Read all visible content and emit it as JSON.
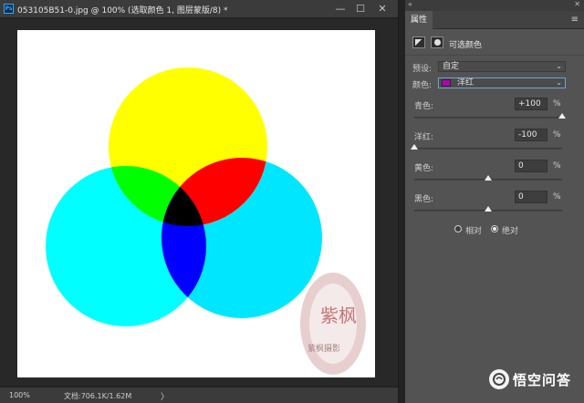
{
  "document": {
    "app_icon": "Ps",
    "title": "053105B51-0.jpg @ 100% (选取颜色 1, 图层蒙版/8) *",
    "window_controls": {
      "minimize": "—",
      "restore": "☐",
      "close": "✕"
    },
    "status": {
      "zoom": "100%",
      "doc_info": "文档:706.1K/1.62M",
      "arrow": "〉"
    },
    "image": {
      "circles": [
        {
          "name": "yellow",
          "color": "#ffff00"
        },
        {
          "name": "cyan-left",
          "color": "#00ffff"
        },
        {
          "name": "cyan-right",
          "color": "#00e6ff"
        }
      ],
      "overlaps": {
        "green": "#00ff00",
        "red": "#ff0000",
        "blue": "#0000ff",
        "black": "#000000"
      },
      "seal_char": "紫枫",
      "seal_caption": "紫枫摄影"
    }
  },
  "panel": {
    "collapse_icon": "«",
    "close_icon": "✕",
    "tab": "属性",
    "menu_icon": "≡",
    "adjustment_title": "可选颜色",
    "preset": {
      "label": "预设:",
      "value": "自定"
    },
    "colors": {
      "label": "颜色:",
      "value": "洋红",
      "swatch": "#b400b4"
    },
    "sliders": [
      {
        "label": "青色:",
        "value": "+100",
        "unit": "%",
        "level": 100
      },
      {
        "label": "洋红:",
        "value": "-100",
        "unit": "%",
        "level": -100
      },
      {
        "label": "黄色:",
        "value": "0",
        "unit": "%",
        "level": 0
      },
      {
        "label": "黑色:",
        "value": "0",
        "unit": "%",
        "level": 0
      }
    ],
    "method": {
      "relative": "相对",
      "absolute": "绝对",
      "selected": "absolute"
    }
  },
  "watermark": {
    "text": "悟空问答"
  }
}
